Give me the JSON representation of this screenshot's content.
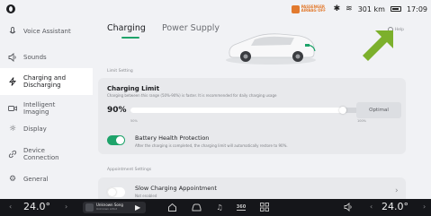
{
  "status": {
    "airbag_line1": "PASSENGER",
    "airbag_line2": "AIRBAG OFF",
    "range": "301 km",
    "time": "17:09"
  },
  "sidebar": {
    "items": [
      {
        "label": "Voice Assistant",
        "icon": "voice-icon"
      },
      {
        "label": "Sounds",
        "icon": "speaker-icon"
      },
      {
        "label": "Charging and Discharging",
        "icon": "charging-icon",
        "active": true
      },
      {
        "label": "Intelligent Imaging",
        "icon": "camera-icon"
      },
      {
        "label": "Display",
        "icon": "sun-icon"
      },
      {
        "label": "Device Connection",
        "icon": "link-icon"
      },
      {
        "label": "General",
        "icon": "gear-icon"
      }
    ]
  },
  "tabs": [
    {
      "label": "Charging",
      "active": true
    },
    {
      "label": "Power Supply",
      "active": false
    }
  ],
  "help_label": "Help",
  "limit_setting": {
    "section_title": "Limit Setting",
    "title": "Charging Limit",
    "subtitle": "Charging between this range (50%-90%) is faster. It is recommended for daily charging usage",
    "value_text": "90%",
    "value": 0.9,
    "min_label": "50%",
    "max_label": "100%",
    "optimal_label": "Optimal"
  },
  "battery_health": {
    "title": "Battery Health Protection",
    "subtitle": "After the charging is completed, the charging limit will automatically restore to 90%.",
    "enabled": true
  },
  "appointment": {
    "section_title": "Appointment Settings",
    "title": "Slow Charging Appointment",
    "subtitle": "Not enabled",
    "enabled": false
  },
  "bottombar": {
    "temp_left": "24.0°",
    "temp_right": "24.0°",
    "song_title": "Unknown Song",
    "song_artist": "Unknown Artist",
    "cam_label": "360"
  },
  "colors": {
    "accent": "#1ea36a",
    "annotation_arrow": "#7cb02c",
    "airbag": "#e27a2e"
  }
}
